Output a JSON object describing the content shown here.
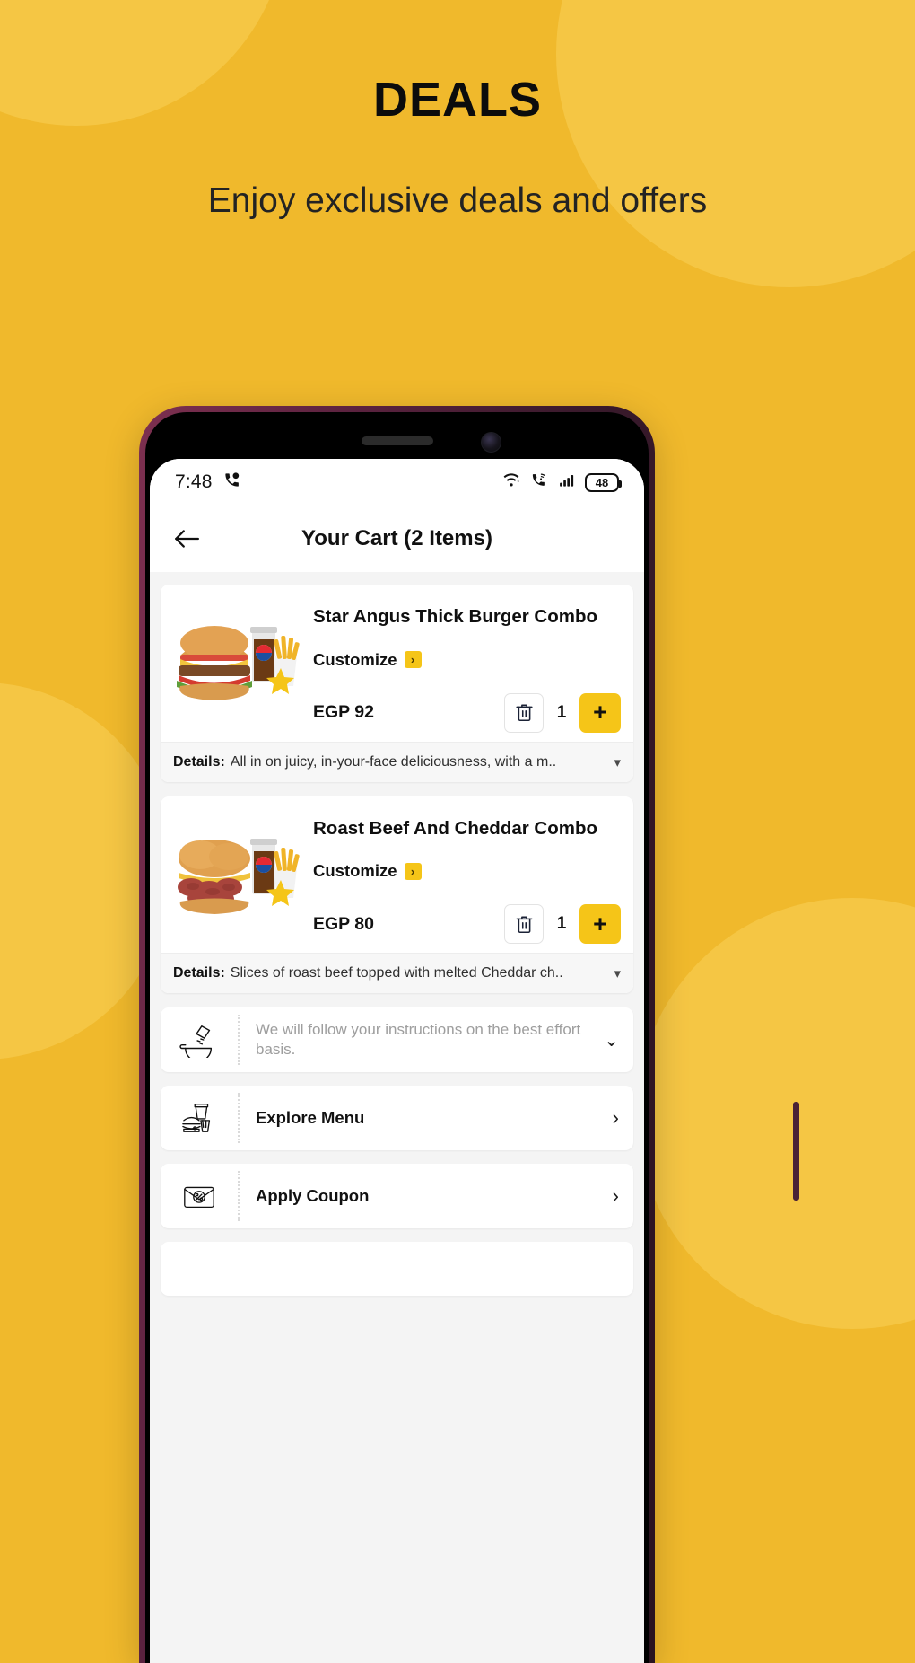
{
  "promo": {
    "title": "DEALS",
    "subtitle": "Enjoy exclusive deals and offers",
    "bg_color": "#f0b92c",
    "blob_color": "#f5c644"
  },
  "status_bar": {
    "time": "7:48",
    "call_icon": "phone-call-icon",
    "wifi_icon": "wifi-icon",
    "vowifi_icon": "vowifi-call-icon",
    "signal_icon": "cellular-signal-icon",
    "battery_level": "48"
  },
  "app_bar": {
    "back_icon": "back-arrow-icon",
    "title": "Your Cart (2 Items)"
  },
  "cart": {
    "items": [
      {
        "name": "Star Angus Thick Burger Combo",
        "customize_label": "Customize",
        "price": "EGP 92",
        "quantity": "1",
        "delete_icon": "trash-icon",
        "add_label": "+",
        "details_label": "Details:",
        "details_text": "All in on juicy, in-your-face deliciousness, with a m..",
        "image": "burger-combo-image"
      },
      {
        "name": "Roast Beef And Cheddar Combo",
        "customize_label": "Customize",
        "price": "EGP 80",
        "quantity": "1",
        "delete_icon": "trash-icon",
        "add_label": "+",
        "details_label": "Details:",
        "details_text": "Slices of roast beef topped with melted Cheddar ch..",
        "image": "roast-beef-combo-image"
      }
    ],
    "actions": [
      {
        "icon": "cooking-instructions-icon",
        "label": "We will follow your instructions on the best effort basis.",
        "chevron": "˅",
        "muted": true
      },
      {
        "icon": "menu-meal-icon",
        "label": "Explore Menu",
        "chevron": "›",
        "muted": false
      },
      {
        "icon": "coupon-icon",
        "label": "Apply Coupon",
        "chevron": "›",
        "muted": false
      }
    ]
  },
  "colors": {
    "accent": "#f5c518",
    "screen_bg": "#f4f4f4"
  }
}
